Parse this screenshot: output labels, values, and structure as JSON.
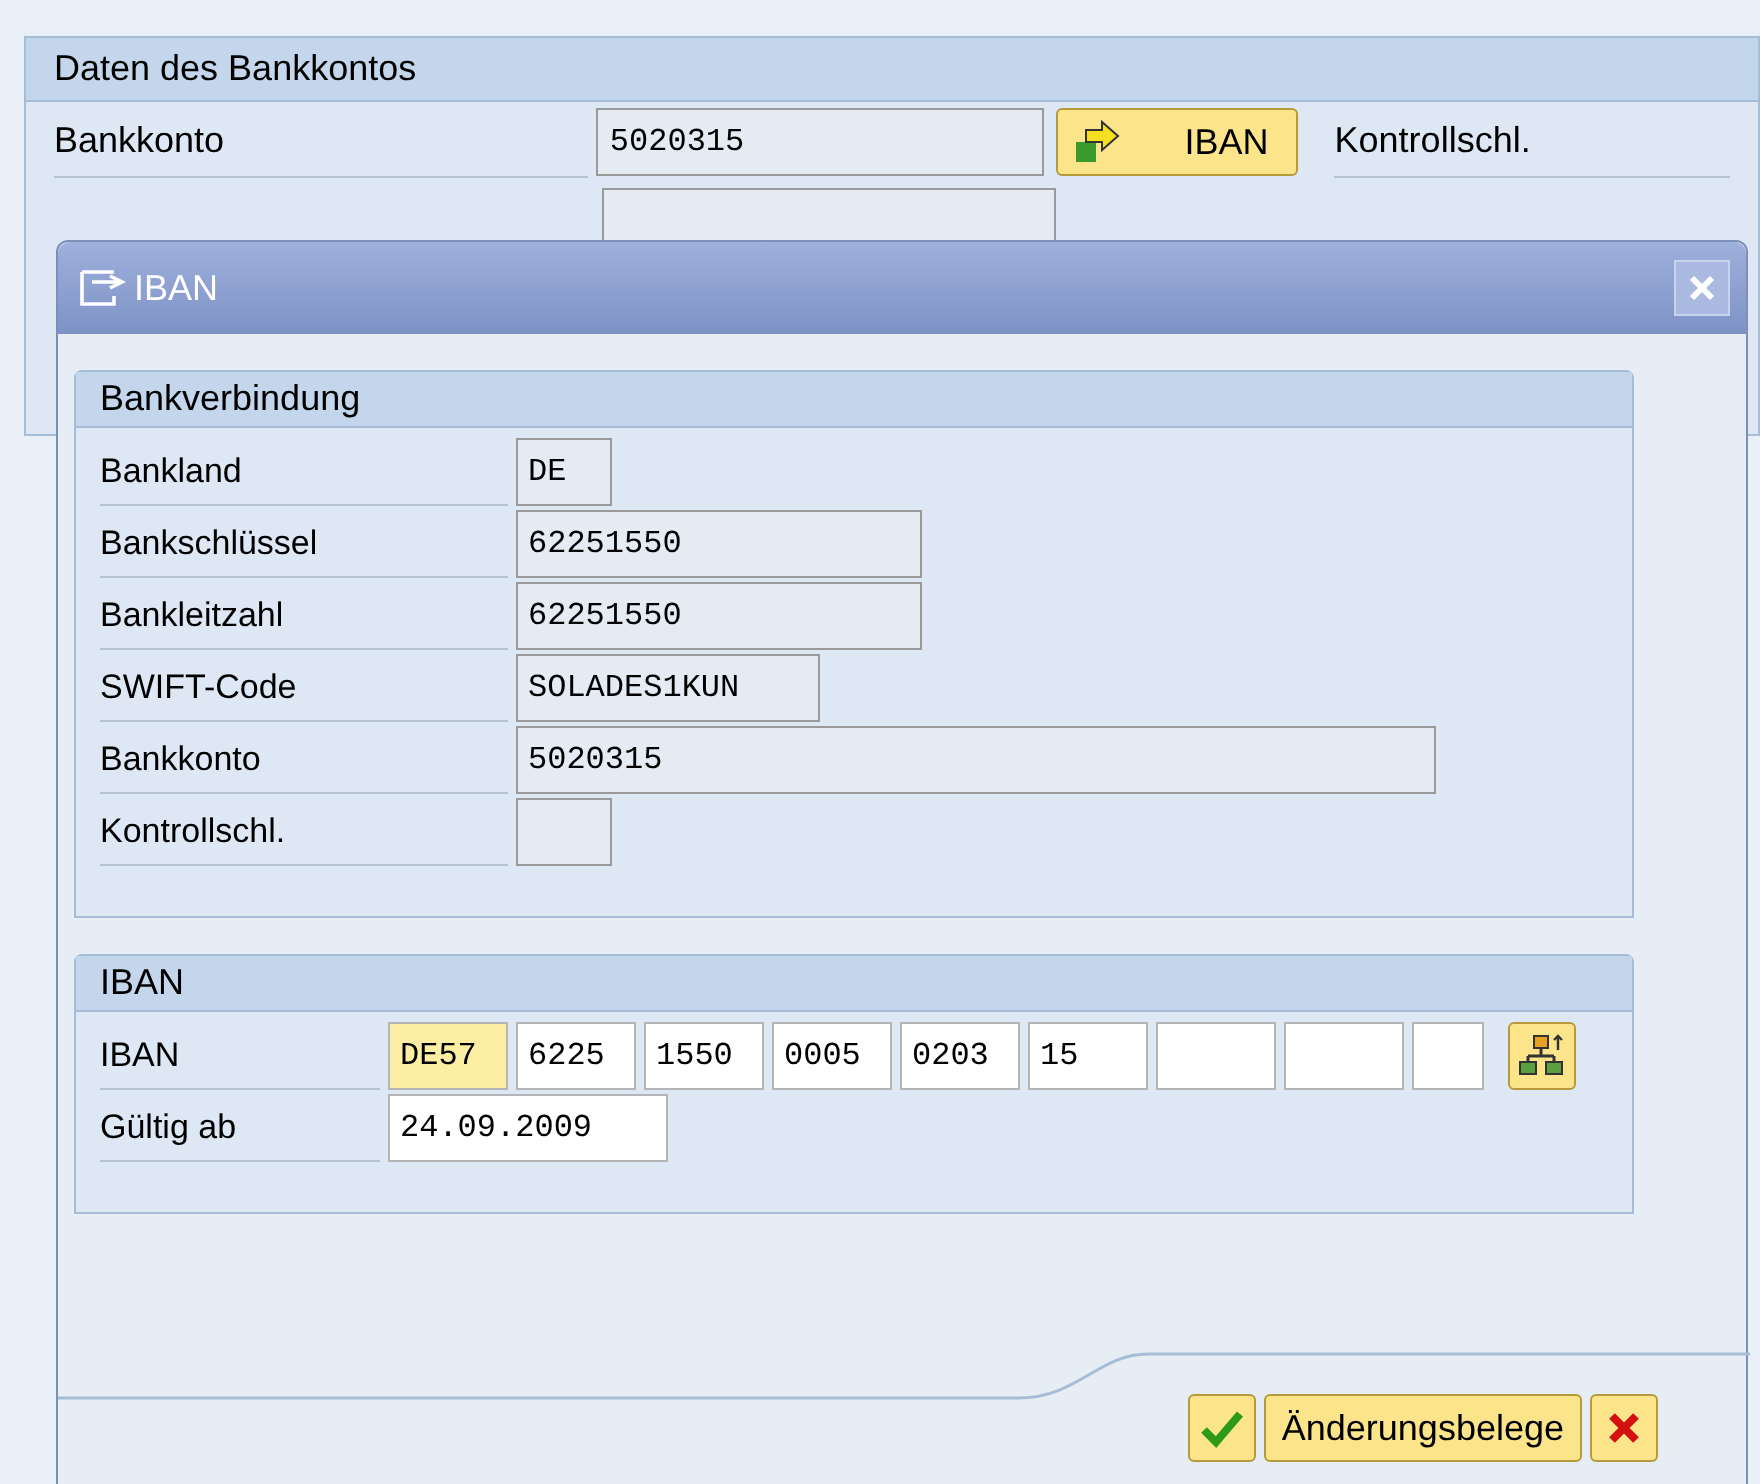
{
  "background_panel": {
    "title": "Daten des Bankkontos",
    "fields": [
      {
        "label": "Bankkonto",
        "value": "5020315"
      }
    ],
    "iban_button": "IBAN",
    "side_label": "Kontrollschl."
  },
  "dialog": {
    "title": "IBAN",
    "groups": [
      {
        "title": "Bankverbindung",
        "rows": [
          {
            "label": "Bankland",
            "fields": [
              {
                "value": "DE",
                "editable": false,
                "highlighted": false
              }
            ]
          },
          {
            "label": "Bankschlüssel",
            "fields": [
              {
                "value": "62251550",
                "editable": false,
                "highlighted": false
              }
            ]
          },
          {
            "label": "Bankleitzahl",
            "fields": [
              {
                "value": "62251550",
                "editable": false,
                "highlighted": false
              }
            ]
          },
          {
            "label": "SWIFT-Code",
            "fields": [
              {
                "value": "SOLADES1KUN",
                "editable": false,
                "highlighted": false
              }
            ]
          },
          {
            "label": "Bankkonto",
            "fields": [
              {
                "value": "5020315",
                "editable": false,
                "highlighted": false
              }
            ]
          },
          {
            "label": "Kontrollschl.",
            "fields": [
              {
                "editable": false,
                "highlighted": false
              }
            ]
          }
        ]
      },
      {
        "title": "IBAN",
        "rows": [
          {
            "label": "IBAN",
            "has_action": true,
            "fields": [
              {
                "value": "DE57",
                "editable": true,
                "highlighted": true
              },
              {
                "value": "6225",
                "editable": true,
                "highlighted": false
              },
              {
                "value": "1550",
                "editable": true,
                "highlighted": false
              },
              {
                "value": "0005",
                "editable": true,
                "highlighted": false
              },
              {
                "value": "0203",
                "editable": true,
                "highlighted": false
              },
              {
                "value": "15",
                "editable": true,
                "highlighted": false
              },
              {
                "editable": true,
                "highlighted": false
              },
              {
                "editable": true,
                "highlighted": false
              },
              {
                "editable": true,
                "highlighted": false
              }
            ]
          },
          {
            "label": "Gültig ab",
            "fields": [
              {
                "value": "24.09.2009",
                "editable": true,
                "highlighted": false
              }
            ]
          }
        ]
      }
    ],
    "buttons": [
      {
        "kind": "confirm"
      },
      {
        "kind": "text",
        "label": "Änderungsbelege"
      },
      {
        "kind": "cancel"
      }
    ]
  }
}
